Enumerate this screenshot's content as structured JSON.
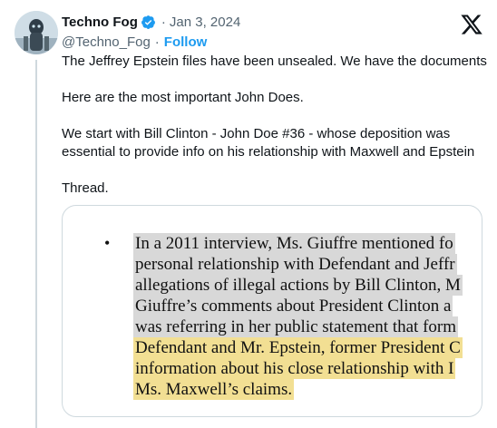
{
  "tweet": {
    "author_name": "Techno Fog",
    "author_handle": "@Techno_Fog",
    "separator": "·",
    "date": "Jan 3, 2024",
    "follow_label": "Follow",
    "verified_icon": "verified-badge-icon",
    "platform_icon": "x-logo-icon",
    "paragraphs": [
      "The Jeffrey Epstein files have been unsealed. We have the documents",
      "Here are the most important John Does.",
      "We start with Bill Clinton - John Doe #36 - whose deposition was essential to provide info on his relationship with Maxwell and Epstein",
      "Thread."
    ]
  },
  "document_image": {
    "bullet": "•",
    "lines": [
      {
        "text": "In a 2011 interview, Ms. Giuffre mentioned fo",
        "highlight": "gray"
      },
      {
        "text": "personal relationship with Defendant and Jeffr",
        "highlight": "gray"
      },
      {
        "text": "allegations of illegal actions by Bill Clinton, M",
        "highlight": "gray"
      },
      {
        "text": "Giuffre’s comments about President Clinton a",
        "highlight": "gray"
      },
      {
        "text": "was referring in her public statement that form",
        "highlight": "gray"
      },
      {
        "text": "Defendant and Mr. Epstein, former President C",
        "highlight": "yellow"
      },
      {
        "text": "information about his close relationship with I",
        "highlight": "yellow"
      },
      {
        "text": "Ms. Maxwell’s claims.",
        "highlight": "yellow"
      }
    ]
  },
  "colors": {
    "text": "#0f1419",
    "muted": "#536471",
    "accent": "#1d9bf0",
    "highlight_gray": "#d8d8d8",
    "highlight_yellow": "#f2df93"
  }
}
